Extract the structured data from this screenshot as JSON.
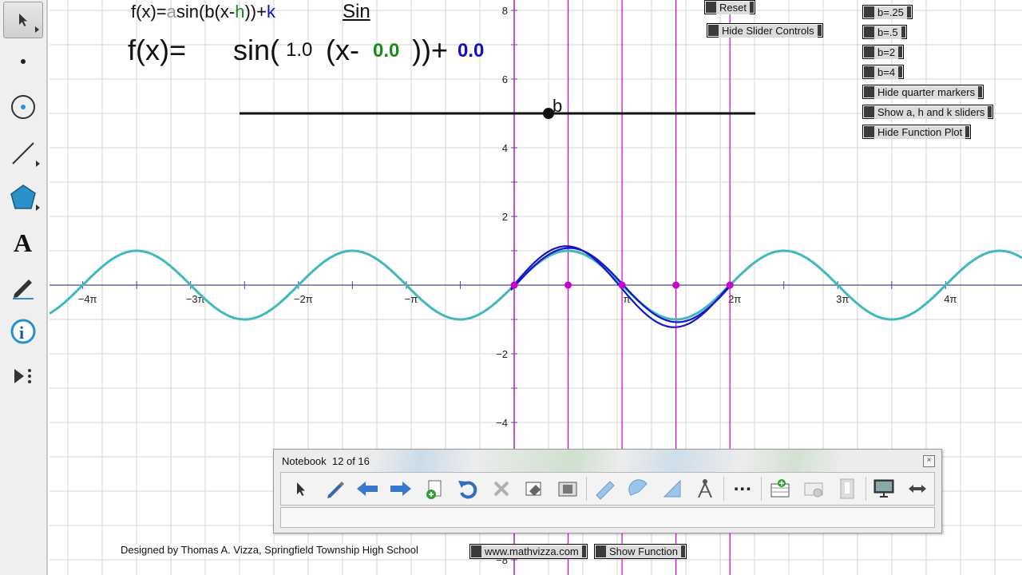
{
  "toolbox": {
    "tools": [
      "arrow-tool",
      "point-tool",
      "compass-tool",
      "straightedge-tool",
      "polygon-tool",
      "text-tool",
      "marker-tool",
      "information-tool",
      "custom-tool"
    ]
  },
  "formula": {
    "general": {
      "prefix": "f(x)=",
      "a": "a",
      "mid1": "sin(b(x-",
      "h": "h",
      "mid2": "))+",
      "k": "k"
    },
    "sin_link": "Sin",
    "current": {
      "lhs": "f(x)=",
      "sin_open": "sin(",
      "b_value": "1.0",
      "x_minus": "(x-",
      "h_value": "0.0",
      "close_plus": "))+",
      "k_value": "0.0"
    },
    "colors": {
      "h": "#1a8a1a",
      "k": "#1010c0",
      "a": "#888888"
    }
  },
  "slider": {
    "label": "b"
  },
  "buttons": {
    "reset": "Reset",
    "hide_slider_controls": "Hide Slider Controls",
    "b_025": "b=.25",
    "b_05": "b=.5",
    "b_2": "b=2",
    "b_4": "b=4",
    "hide_quarter_markers": "Hide quarter markers",
    "show_ahk_sliders": "Show a, h and k sliders",
    "hide_function_plot": "Hide Function Plot",
    "website": "www.mathvizza.com",
    "show_function": "Show Function"
  },
  "credits": "Designed by Thomas A. Vizza, Springfield Township High School",
  "graph": {
    "x_ticks": [
      "−4π",
      "−3π",
      "−2π",
      "−π",
      "π",
      "2π",
      "3π",
      "4π"
    ],
    "y_ticks": [
      "8",
      "6",
      "4",
      "2",
      "−2",
      "−4",
      "−8"
    ],
    "colors": {
      "function": "#3fb8bf",
      "sketch": "#1515c8",
      "markers": "#cc00cc",
      "grid": "#d6d6d6",
      "axes": "#4a4a8a"
    }
  },
  "notebook": {
    "title": "Notebook",
    "page": "12 of 16",
    "close_icon": "close-icon",
    "tools": [
      "select-icon",
      "pen-icon",
      "back-arrow-icon",
      "forward-arrow-icon",
      "add-page-icon",
      "undo-icon",
      "delete-icon",
      "screen-shade-icon",
      "capture-icon",
      "ruler-icon",
      "protractor-icon",
      "triangle-icon",
      "compass-icon",
      "more-icon",
      "add-table-icon",
      "record-icon",
      "clear-icon",
      "screen-icon",
      "resize-icon"
    ],
    "more_label": "..."
  }
}
